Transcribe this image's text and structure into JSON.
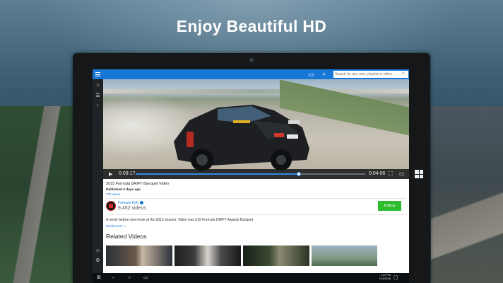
{
  "headline": "Enjoy Beautiful HD",
  "app": {
    "titlebar": {
      "color": "#1777d6",
      "icons": [
        "menu-icon",
        "cast-icon",
        "add-icon"
      ],
      "search_placeholder": "Search for any user, playlist or video",
      "search_icon": "search-icon"
    },
    "rail": {
      "top_icons": [
        "home-icon",
        "list-icon",
        "trending-icon"
      ],
      "bottom_icons": [
        "account-icon",
        "settings-icon"
      ]
    },
    "player": {
      "current_time": "0:09:17",
      "total_time": "0:04:06",
      "progress": 0.71,
      "buttons": [
        "play-icon",
        "fullscreen-icon",
        "cast-icon"
      ]
    },
    "video": {
      "title": "2015 Formula DRIFT Banquet Video",
      "published": "Published 4 days ago",
      "views": "775 views",
      "channel_name": "Formula Drift",
      "channel_videos": "9,452 videos",
      "follow_label": "Follow",
      "description": "A never before seen look at the 2015 season. Video was 015 Formula DRIFT Awards Banquet",
      "read_more": "Read more"
    },
    "related": {
      "heading": "Related Videos",
      "thumbnails": 4
    },
    "taskbar": {
      "time": "2:47 PM",
      "date": "7/13/2016"
    }
  }
}
